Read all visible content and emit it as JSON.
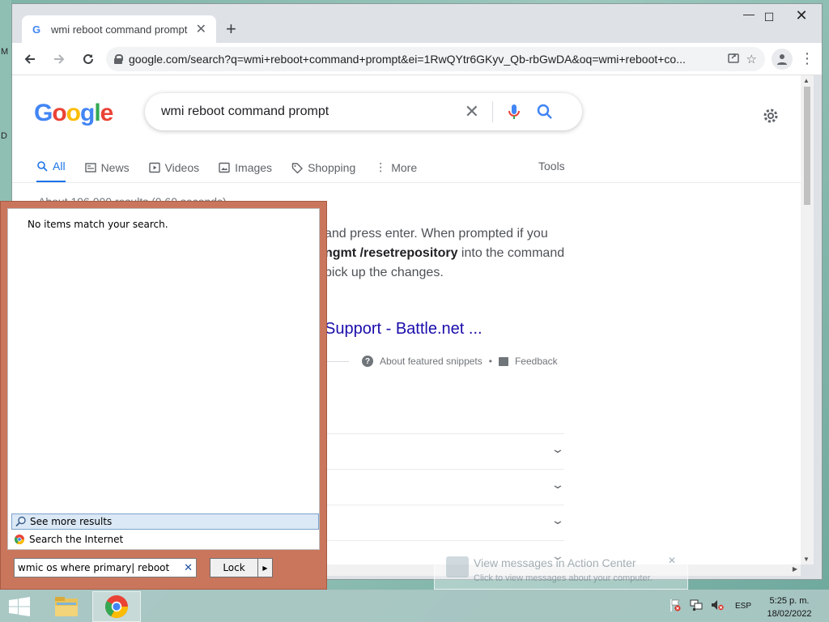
{
  "desktop": {
    "glyph_top": "M",
    "glyph_mid": "D"
  },
  "browser": {
    "tab_title": "wmi reboot command prompt -",
    "new_tab_icon": "plus-icon",
    "url": "google.com/search?q=wmi+reboot+command+prompt&ei=1RwQYtr6GKyv_Qb-rbGwDA&oq=wmi+reboot+co..."
  },
  "google": {
    "logo": "Google",
    "query": "wmi reboot command prompt",
    "tabs": [
      {
        "label": "All",
        "icon": "search-icon"
      },
      {
        "label": "News",
        "icon": "news-icon"
      },
      {
        "label": "Videos",
        "icon": "video-icon"
      },
      {
        "label": "Images",
        "icon": "image-icon"
      },
      {
        "label": "Shopping",
        "icon": "tag-icon"
      },
      {
        "label": "More",
        "icon": "more-vert-icon"
      }
    ],
    "tools": "Tools",
    "stats": "About 196,000 results (0.60 seconds)",
    "snippet_pre": "and press enter. When prompted if you",
    "snippet_bold": "ngmt /resetrepository",
    "snippet_mid": " into the command",
    "snippet_end": "pick up the changes.",
    "result_link": "Support - Battle.net ...",
    "about_snippets": "About featured snippets",
    "dot": "•",
    "feedback": "Feedback"
  },
  "startmenu": {
    "no_items": "No items match your search.",
    "see_more": "See more results",
    "search_internet": "Search the Internet",
    "search_value": "wmic os where primary| reboot",
    "lock_label": "Lock"
  },
  "notification": {
    "title": "View messages in Action Center",
    "subtitle": "Click to view messages about your computer."
  },
  "taskbar": {
    "lang": "ESP",
    "time": "5:25 p. m.",
    "date": "18/02/2022"
  },
  "colors": {
    "google_blue": "#4285f4",
    "google_red": "#ea4335",
    "google_yellow": "#fbbc05",
    "google_green": "#34a853",
    "start_menu_frame": "#c9765d"
  }
}
